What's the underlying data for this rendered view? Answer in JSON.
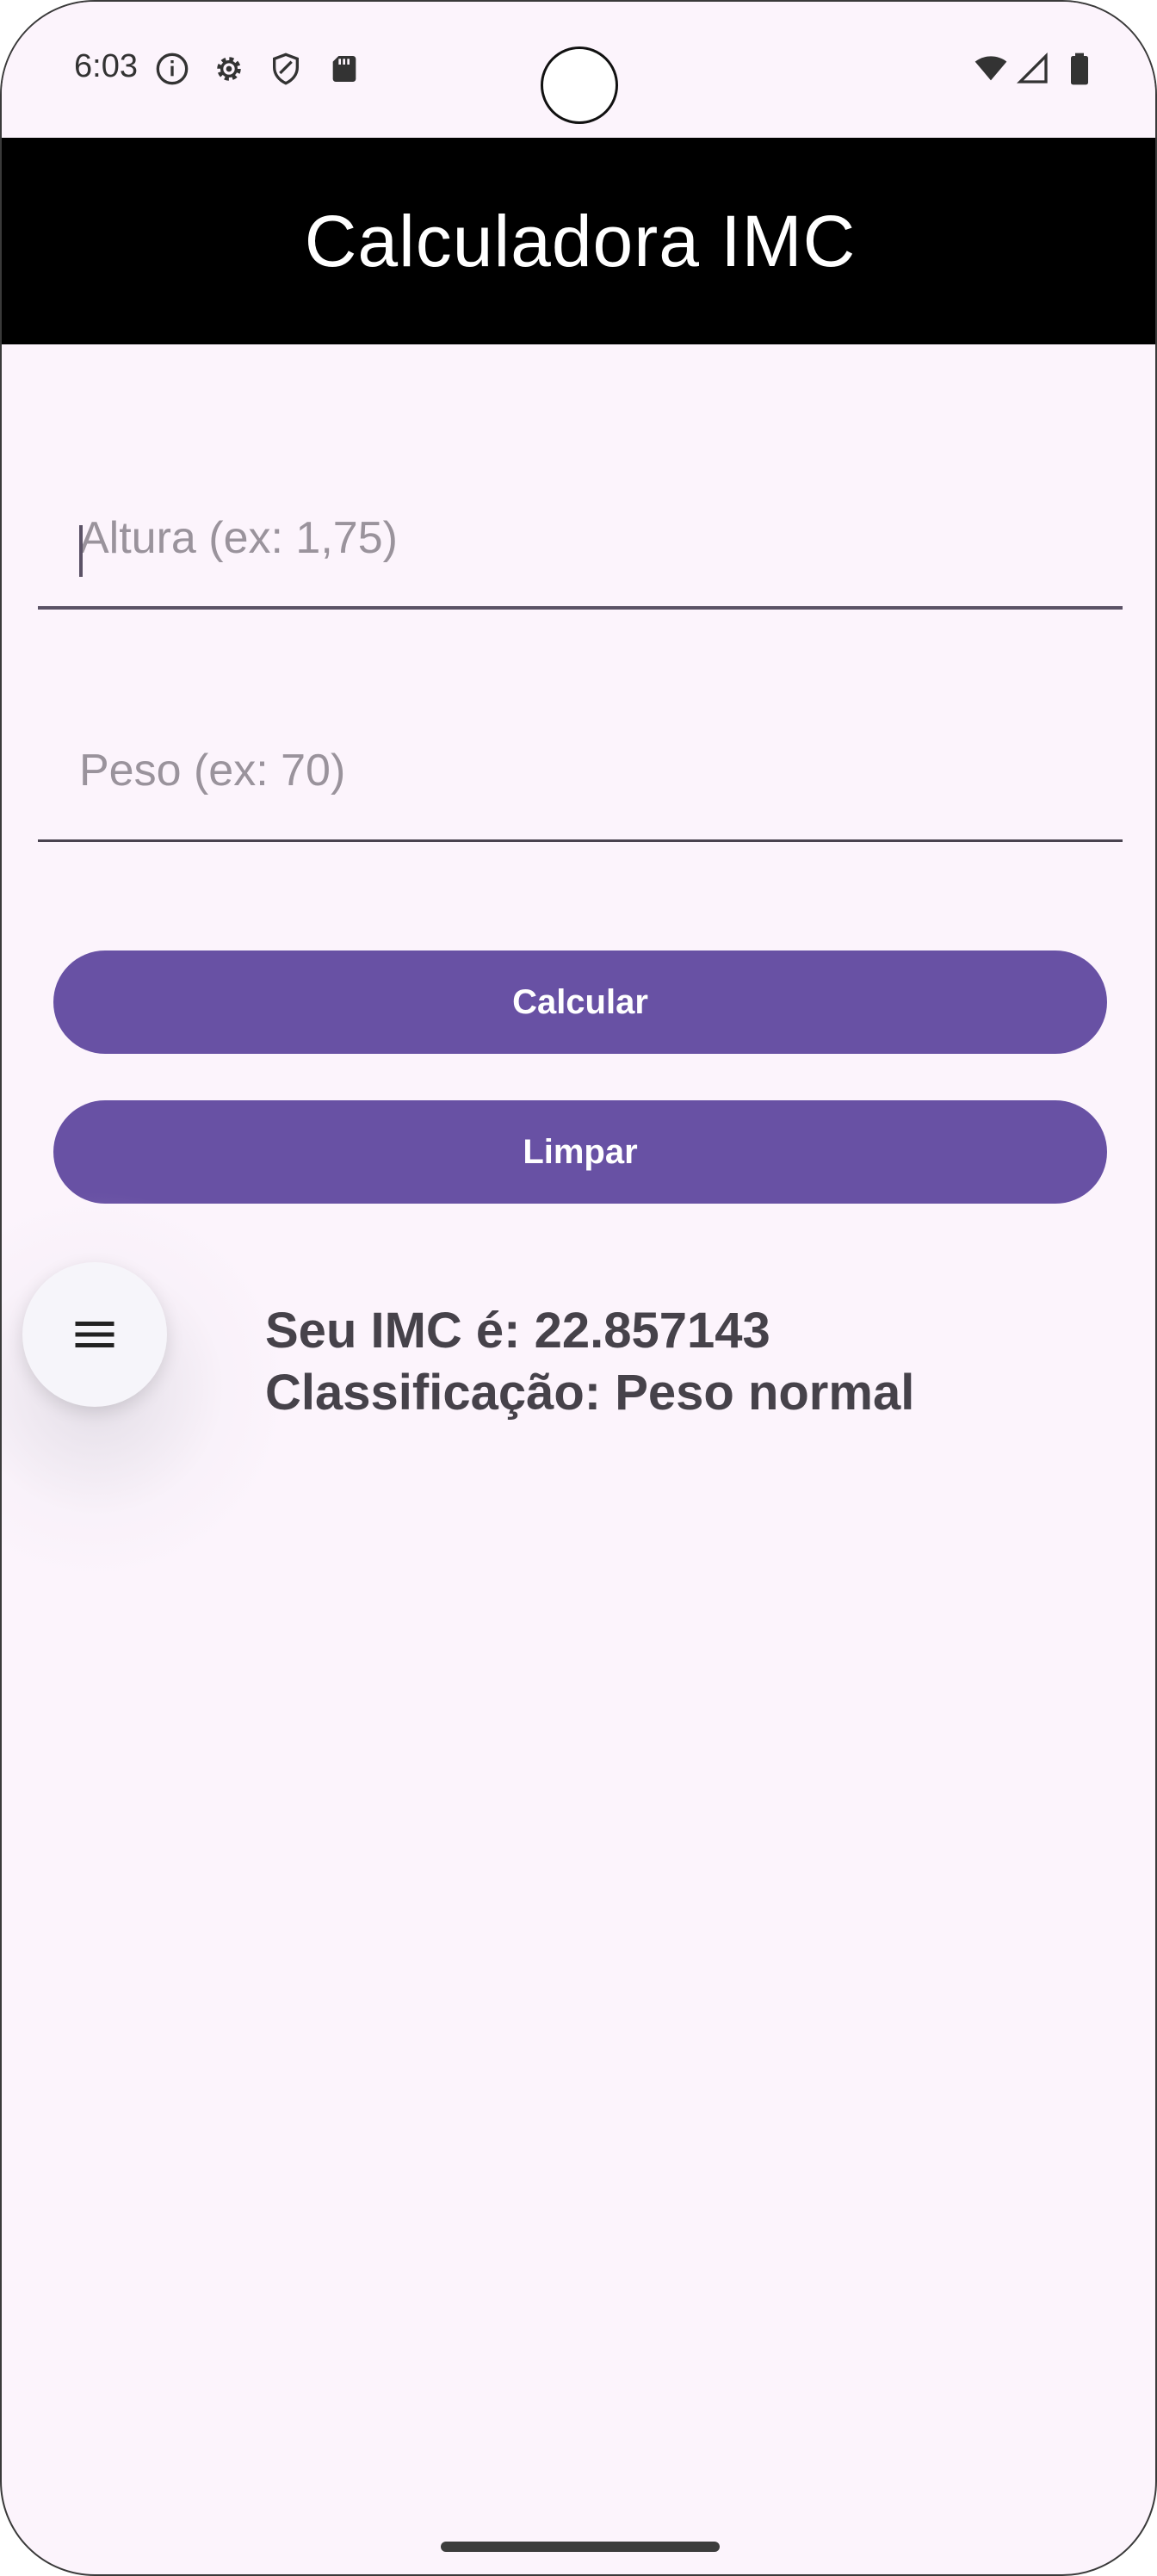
{
  "status_bar": {
    "time": "6:03",
    "icons_left": [
      "info-icon",
      "settings-icon",
      "shield-icon",
      "sd-card-icon"
    ],
    "icons_right": [
      "wifi-icon",
      "signal-icon",
      "battery-icon"
    ]
  },
  "app_bar": {
    "title": "Calculadora IMC"
  },
  "form": {
    "height_field": {
      "placeholder": "Altura (ex: 1,75)",
      "value": ""
    },
    "weight_field": {
      "placeholder": "Peso (ex: 70)",
      "value": ""
    }
  },
  "buttons": {
    "calculate_label": "Calcular",
    "clear_label": "Limpar"
  },
  "menu_fab": {
    "icon": "menu-icon"
  },
  "result": {
    "imc_line": "Seu IMC é: 22.857143",
    "classification_line": "Classificação: Peso normal"
  },
  "colors": {
    "background": "#fcf4fc",
    "app_bar": "#000000",
    "button": "#6851a4",
    "result_text": "#46424a"
  }
}
